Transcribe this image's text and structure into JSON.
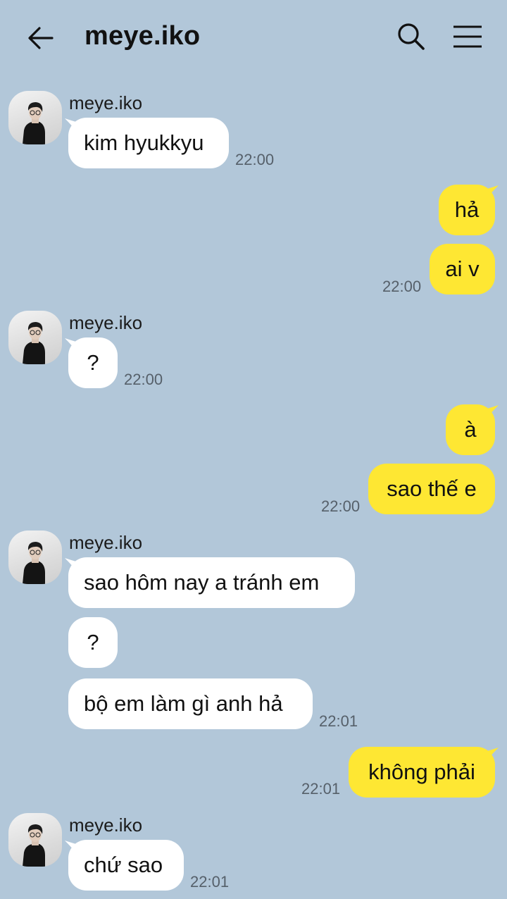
{
  "header": {
    "title": "meye.iko",
    "back_icon": "arrow-left-icon",
    "search_icon": "search-icon",
    "menu_icon": "hamburger-menu-icon"
  },
  "colors": {
    "background": "#b2c7d9",
    "incoming_bubble": "#ffffff",
    "outgoing_bubble": "#fee733"
  },
  "groups": [
    {
      "sender": "meye.iko",
      "messages": [
        "kim hyukkyu"
      ],
      "time": "22:00"
    },
    {
      "messages": [
        "hả",
        "ai v"
      ],
      "time": "22:00"
    },
    {
      "sender": "meye.iko",
      "messages": [
        "?"
      ],
      "time": "22:00"
    },
    {
      "messages": [
        "à",
        "sao thế e"
      ],
      "time": "22:00"
    },
    {
      "sender": "meye.iko",
      "messages": [
        "sao hôm nay a tránh em",
        "?",
        "bộ em làm gì anh hả"
      ],
      "time": "22:01"
    },
    {
      "messages": [
        "không phải"
      ],
      "time": "22:01"
    },
    {
      "sender": "meye.iko",
      "messages": [
        "chứ sao"
      ],
      "time": "22:01"
    }
  ]
}
